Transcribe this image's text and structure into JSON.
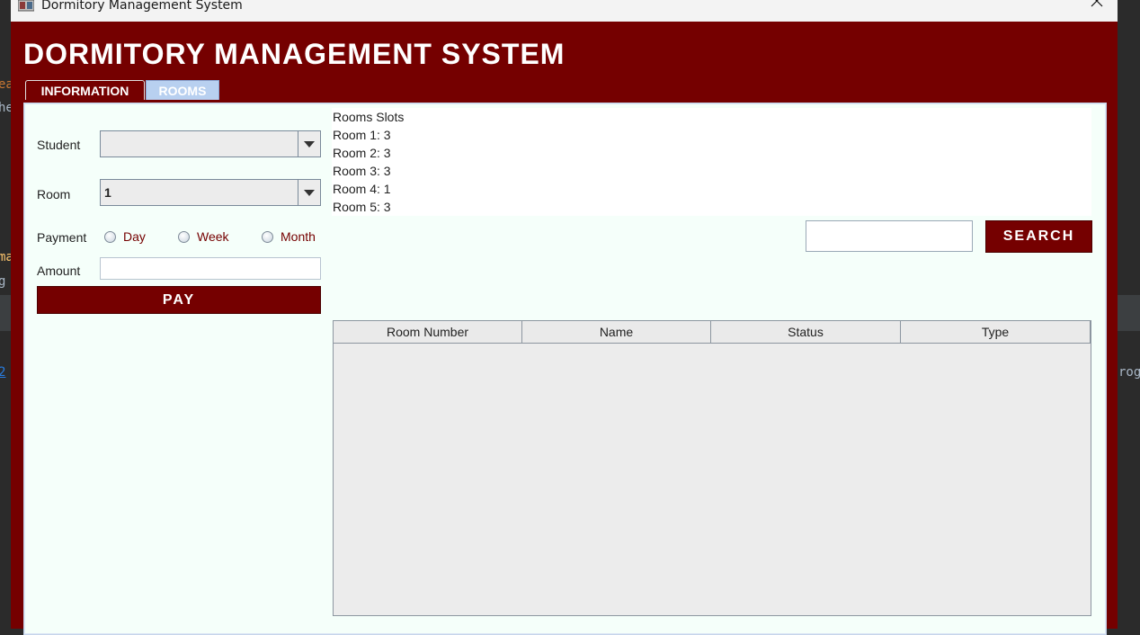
{
  "window": {
    "title": "Dormitory Management System",
    "close_glyph": "✕"
  },
  "app": {
    "heading": "DORMITORY MANAGEMENT SYSTEM"
  },
  "tabs": [
    {
      "label": "INFORMATION",
      "selected": true
    },
    {
      "label": "ROOMS",
      "selected": false
    }
  ],
  "form": {
    "student_label": "Student",
    "student_value": "",
    "room_label": "Room",
    "room_value": "1",
    "payment_label": "Payment",
    "payment_options": [
      "Day",
      "Week",
      "Month"
    ],
    "amount_label": "Amount",
    "amount_value": "",
    "pay_label": "PAY"
  },
  "slots": {
    "header": "Rooms  Slots",
    "lines": [
      "Room 1: 3",
      "Room 2: 3",
      "Room 3: 3",
      "Room 4: 1",
      "Room 5: 3"
    ]
  },
  "search": {
    "value": "",
    "button_label": "SEARCH"
  },
  "table": {
    "columns": [
      "Room Number",
      "Name",
      "Status",
      "Type"
    ],
    "rows": []
  },
  "background": {
    "fragments": [
      "ea",
      "he",
      "ma",
      "g",
      "2",
      "rog"
    ]
  },
  "colors": {
    "brand": "#750000",
    "panel": "#f5fffa",
    "rooms_tab": "#b8d0f0"
  }
}
